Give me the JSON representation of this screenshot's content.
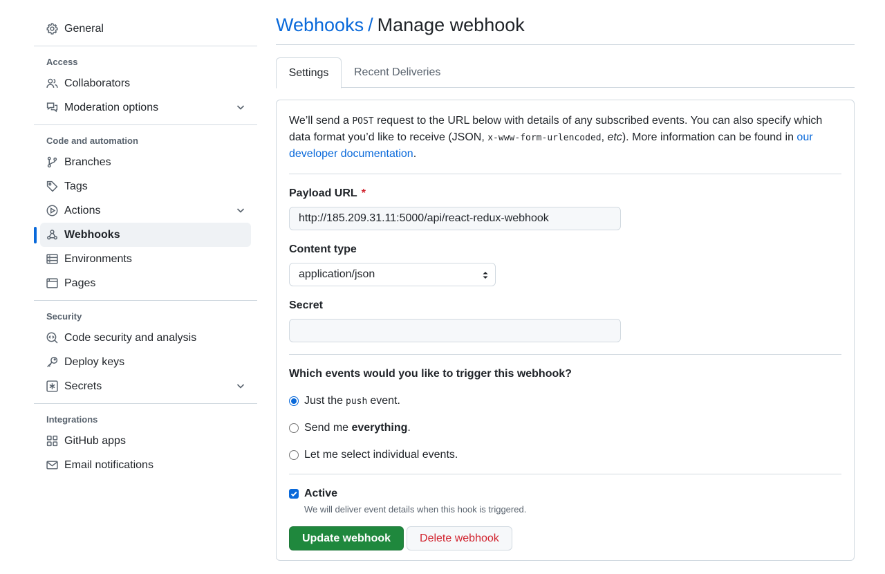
{
  "sidebar": {
    "general": {
      "label": "General",
      "icon": "gear-icon"
    },
    "sections": {
      "access": "Access",
      "code_automation": "Code and automation",
      "security": "Security",
      "integrations": "Integrations"
    },
    "items": {
      "collaborators": "Collaborators",
      "moderation": "Moderation options",
      "branches": "Branches",
      "tags": "Tags",
      "actions": "Actions",
      "webhooks": "Webhooks",
      "environments": "Environments",
      "pages": "Pages",
      "code_security": "Code security and analysis",
      "deploy_keys": "Deploy keys",
      "secrets": "Secrets",
      "github_apps": "GitHub apps",
      "email_notifications": "Email notifications"
    },
    "active_item": "Webhooks"
  },
  "header": {
    "breadcrumb": "Webhooks",
    "separator": "/",
    "title": "Manage webhook"
  },
  "tabs": {
    "settings": "Settings",
    "recent_deliveries": "Recent Deliveries"
  },
  "form": {
    "intro_1": "We’ll send a ",
    "intro_code_1": "POST",
    "intro_2": " request to the URL below with details of any subscribed events. You can also specify which data format you’d like to receive (JSON, ",
    "intro_code_2": "x-www-form-urlencoded",
    "intro_3": ", ",
    "intro_etc": "etc",
    "intro_4": "). More information can be found in ",
    "intro_link": "our developer documentation",
    "intro_5": ".",
    "payload_url_label": "Payload URL",
    "required_mark": "*",
    "payload_url_value": "http://185.209.31.11:5000/api/react-redux-webhook",
    "content_type_label": "Content type",
    "content_type_value": "application/json",
    "secret_label": "Secret",
    "secret_value": "",
    "events_question": "Which events would you like to trigger this webhook?",
    "radio_push_1": "Just the",
    "radio_push_code": "push",
    "radio_push_2": "event.",
    "radio_everything_1": "Send me ",
    "radio_everything_bold": "everything",
    "radio_everything_2": ".",
    "radio_select": "Let me select individual events.",
    "active_label": "Active",
    "active_hint": "We will deliver event details when this hook is triggered.",
    "update_button": "Update webhook",
    "delete_button": "Delete webhook"
  },
  "colors": {
    "accent": "#0969da",
    "primary_button": "#1f883d",
    "danger": "#d1242f"
  }
}
